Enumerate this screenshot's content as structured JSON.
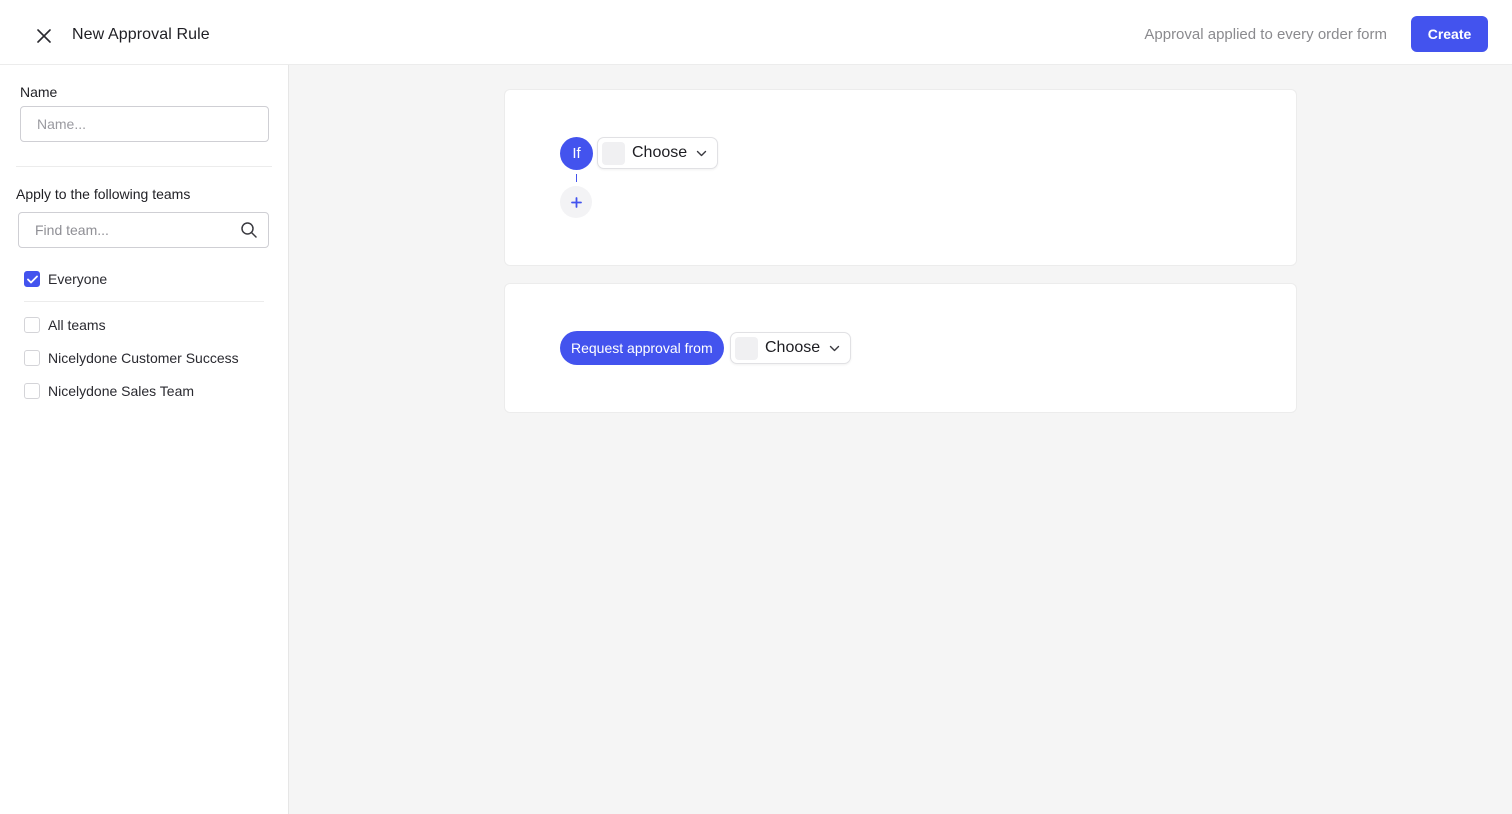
{
  "header": {
    "title": "New Approval Rule",
    "applied_text": "Approval applied to every order form",
    "create_label": "Create",
    "accent_color": "#4353ee"
  },
  "sidebar": {
    "name_label": "Name",
    "name_input": {
      "value": "",
      "placeholder": "Name..."
    },
    "teams_label": "Apply to the following teams",
    "team_search": {
      "value": "",
      "placeholder": "Find team..."
    },
    "everyone": {
      "label": "Everyone",
      "checked": true
    },
    "teams": [
      {
        "label": "All teams",
        "checked": false
      },
      {
        "label": "Nicelydone Customer Success",
        "checked": false
      },
      {
        "label": "Nicelydone Sales Team",
        "checked": false
      }
    ]
  },
  "condition": {
    "if_label": "If",
    "choose_label": "Choose",
    "add_icon": "plus-icon"
  },
  "approval": {
    "request_label": "Request approval from",
    "choose_label": "Choose"
  }
}
